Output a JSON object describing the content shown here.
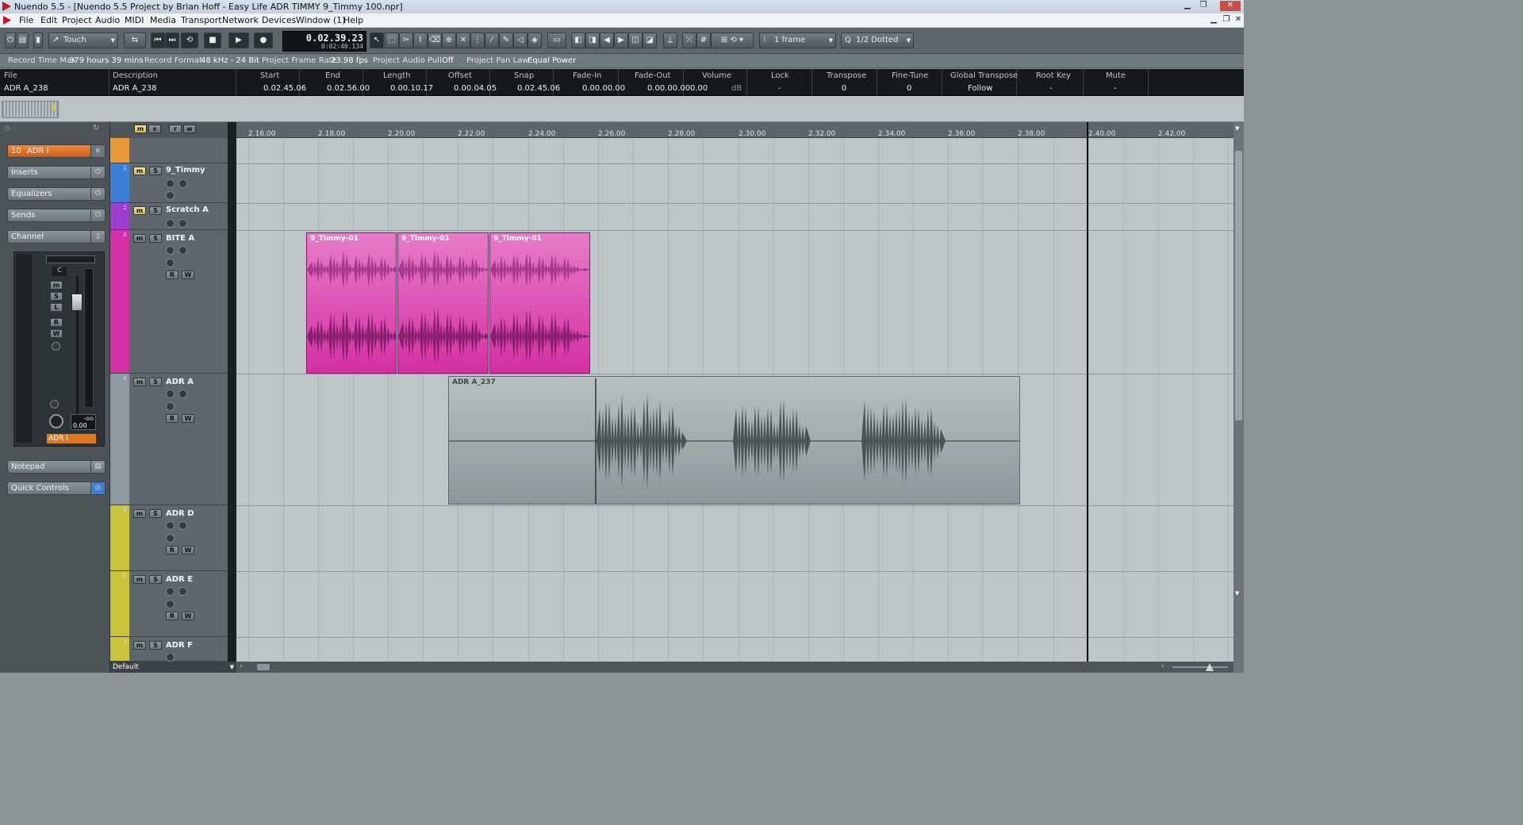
{
  "window": {
    "title": "Nuendo 5.5 - [Nuendo 5.5 Project by Brian Hoff - Easy Life ADR TIMMY 9_Timmy 100.npr]"
  },
  "menu": [
    "File",
    "Edit",
    "Project",
    "Audio",
    "MIDI",
    "Media",
    "Transport",
    "Network",
    "Devices",
    "Window (1)",
    "Help"
  ],
  "toolbar": {
    "automation_mode": "Touch",
    "time_main": "0.02.39.23",
    "time_sub": "0:02:40.134",
    "quantize": "1 frame",
    "grid_type": "1/2 Dotted"
  },
  "status": {
    "record_time_label": "Record Time Max",
    "record_time_value": "379 hours 39 mins",
    "record_format_label": "Record Format",
    "record_format_value": "48 kHz - 24 Bit",
    "frame_rate_label": "Project Frame Rate",
    "frame_rate_value": "23.98 fps",
    "audio_pull_label": "Project Audio Pull",
    "audio_pull_value": "Off",
    "pan_law_label": "Project Pan Law",
    "pan_law_value": "Equal Power"
  },
  "infoline": {
    "headers": [
      "File",
      "Description",
      "Start",
      "End",
      "Length",
      "Offset",
      "Snap",
      "Fade-In",
      "Fade-Out",
      "Volume",
      "Lock",
      "Transpose",
      "Fine-Tune",
      "Global Transpose",
      "Root Key",
      "Mute"
    ],
    "values": [
      "ADR A_238",
      "ADR A_238",
      "0.02.45.06",
      "0.02.56.00",
      "0.00.10.17",
      "0.00.04.05",
      "0.02.45.06",
      "0.00.00.00",
      "0.00.00.00",
      "0.00",
      "-",
      "0",
      "0",
      "Follow",
      "-",
      "-"
    ],
    "volume_unit": "dB"
  },
  "inspector": {
    "track_num": "10",
    "track_name": "ADR I",
    "sections": [
      "Inserts",
      "Equalizers",
      "Sends",
      "Channel",
      "Notepad",
      "Quick Controls"
    ],
    "channel": {
      "pan": "C",
      "volume": "0.00",
      "peak": "-oo",
      "name": "ADR I"
    }
  },
  "tracks": [
    {
      "num": "1",
      "name": "9_Timmy",
      "color": "#3d7fd6"
    },
    {
      "num": "2",
      "name": "Scratch A",
      "color": "#9c3fd0"
    },
    {
      "num": "3",
      "name": "BITE A",
      "color": "#d52fa8"
    },
    {
      "num": "4",
      "name": "ADR A",
      "color": "#8f9a9e"
    },
    {
      "num": "5",
      "name": "ADR D",
      "color": "#c9c43a"
    },
    {
      "num": "6",
      "name": "ADR E",
      "color": "#c9c43a"
    },
    {
      "num": "7",
      "name": "ADR F",
      "color": "#c9c43a"
    }
  ],
  "ruler": [
    "2.16.00",
    "2.18.00",
    "2.20.00",
    "2.22.00",
    "2.24.00",
    "2.26.00",
    "2.28.00",
    "2.30.00",
    "2.32.00",
    "2.34.00",
    "2.36.00",
    "2.38.00",
    "2.40.00",
    "2.42.00"
  ],
  "events": [
    {
      "name": "9_Timmy-01"
    },
    {
      "name": "9_Timmy-01"
    },
    {
      "name": "9_Timmy-01"
    },
    {
      "name": "ADR A_237"
    }
  ],
  "bottom": {
    "preset": "Default"
  },
  "buttons": {
    "m": "m",
    "s": "S",
    "r": "R",
    "w": "W",
    "e": "e",
    "l": "L"
  }
}
